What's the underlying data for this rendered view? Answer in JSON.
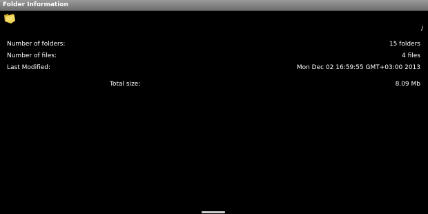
{
  "dialog": {
    "title": "Folder Information"
  },
  "folder": {
    "icon": "folder-icon",
    "icon_color": "#e8c540",
    "path": "/"
  },
  "details": [
    {
      "label": "Number of folders:",
      "value": "15 folders"
    },
    {
      "label": "Number of files:",
      "value": "4 files"
    },
    {
      "label": "Last Modified:",
      "value": "Mon Dec 02 16:59:55 GMT+03:00 2013"
    }
  ],
  "total": {
    "label": "Total size:",
    "value": "8.09 Mb"
  }
}
